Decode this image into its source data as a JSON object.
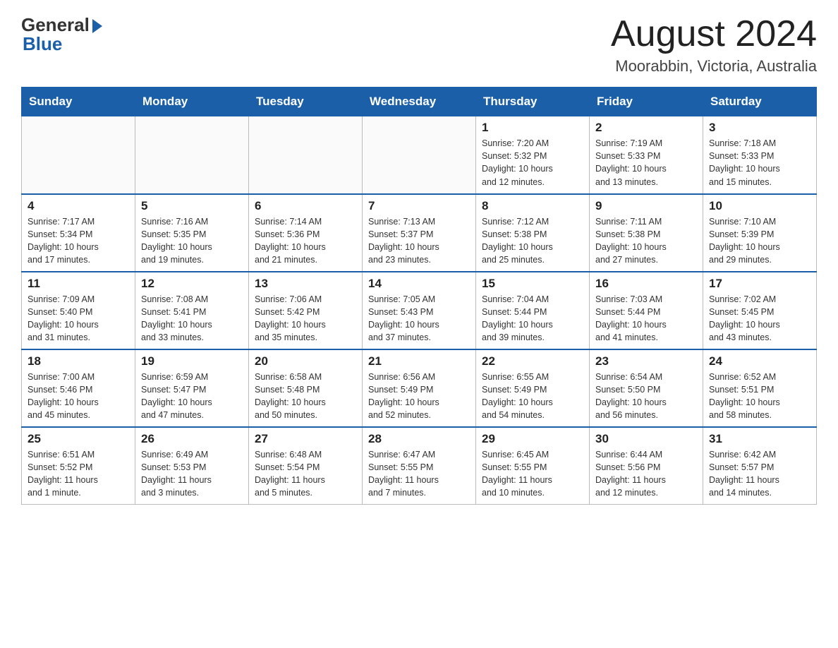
{
  "logo": {
    "general": "General",
    "blue": "Blue"
  },
  "title": "August 2024",
  "location": "Moorabbin, Victoria, Australia",
  "days_of_week": [
    "Sunday",
    "Monday",
    "Tuesday",
    "Wednesday",
    "Thursday",
    "Friday",
    "Saturday"
  ],
  "weeks": [
    [
      {
        "day": "",
        "info": ""
      },
      {
        "day": "",
        "info": ""
      },
      {
        "day": "",
        "info": ""
      },
      {
        "day": "",
        "info": ""
      },
      {
        "day": "1",
        "info": "Sunrise: 7:20 AM\nSunset: 5:32 PM\nDaylight: 10 hours\nand 12 minutes."
      },
      {
        "day": "2",
        "info": "Sunrise: 7:19 AM\nSunset: 5:33 PM\nDaylight: 10 hours\nand 13 minutes."
      },
      {
        "day": "3",
        "info": "Sunrise: 7:18 AM\nSunset: 5:33 PM\nDaylight: 10 hours\nand 15 minutes."
      }
    ],
    [
      {
        "day": "4",
        "info": "Sunrise: 7:17 AM\nSunset: 5:34 PM\nDaylight: 10 hours\nand 17 minutes."
      },
      {
        "day": "5",
        "info": "Sunrise: 7:16 AM\nSunset: 5:35 PM\nDaylight: 10 hours\nand 19 minutes."
      },
      {
        "day": "6",
        "info": "Sunrise: 7:14 AM\nSunset: 5:36 PM\nDaylight: 10 hours\nand 21 minutes."
      },
      {
        "day": "7",
        "info": "Sunrise: 7:13 AM\nSunset: 5:37 PM\nDaylight: 10 hours\nand 23 minutes."
      },
      {
        "day": "8",
        "info": "Sunrise: 7:12 AM\nSunset: 5:38 PM\nDaylight: 10 hours\nand 25 minutes."
      },
      {
        "day": "9",
        "info": "Sunrise: 7:11 AM\nSunset: 5:38 PM\nDaylight: 10 hours\nand 27 minutes."
      },
      {
        "day": "10",
        "info": "Sunrise: 7:10 AM\nSunset: 5:39 PM\nDaylight: 10 hours\nand 29 minutes."
      }
    ],
    [
      {
        "day": "11",
        "info": "Sunrise: 7:09 AM\nSunset: 5:40 PM\nDaylight: 10 hours\nand 31 minutes."
      },
      {
        "day": "12",
        "info": "Sunrise: 7:08 AM\nSunset: 5:41 PM\nDaylight: 10 hours\nand 33 minutes."
      },
      {
        "day": "13",
        "info": "Sunrise: 7:06 AM\nSunset: 5:42 PM\nDaylight: 10 hours\nand 35 minutes."
      },
      {
        "day": "14",
        "info": "Sunrise: 7:05 AM\nSunset: 5:43 PM\nDaylight: 10 hours\nand 37 minutes."
      },
      {
        "day": "15",
        "info": "Sunrise: 7:04 AM\nSunset: 5:44 PM\nDaylight: 10 hours\nand 39 minutes."
      },
      {
        "day": "16",
        "info": "Sunrise: 7:03 AM\nSunset: 5:44 PM\nDaylight: 10 hours\nand 41 minutes."
      },
      {
        "day": "17",
        "info": "Sunrise: 7:02 AM\nSunset: 5:45 PM\nDaylight: 10 hours\nand 43 minutes."
      }
    ],
    [
      {
        "day": "18",
        "info": "Sunrise: 7:00 AM\nSunset: 5:46 PM\nDaylight: 10 hours\nand 45 minutes."
      },
      {
        "day": "19",
        "info": "Sunrise: 6:59 AM\nSunset: 5:47 PM\nDaylight: 10 hours\nand 47 minutes."
      },
      {
        "day": "20",
        "info": "Sunrise: 6:58 AM\nSunset: 5:48 PM\nDaylight: 10 hours\nand 50 minutes."
      },
      {
        "day": "21",
        "info": "Sunrise: 6:56 AM\nSunset: 5:49 PM\nDaylight: 10 hours\nand 52 minutes."
      },
      {
        "day": "22",
        "info": "Sunrise: 6:55 AM\nSunset: 5:49 PM\nDaylight: 10 hours\nand 54 minutes."
      },
      {
        "day": "23",
        "info": "Sunrise: 6:54 AM\nSunset: 5:50 PM\nDaylight: 10 hours\nand 56 minutes."
      },
      {
        "day": "24",
        "info": "Sunrise: 6:52 AM\nSunset: 5:51 PM\nDaylight: 10 hours\nand 58 minutes."
      }
    ],
    [
      {
        "day": "25",
        "info": "Sunrise: 6:51 AM\nSunset: 5:52 PM\nDaylight: 11 hours\nand 1 minute."
      },
      {
        "day": "26",
        "info": "Sunrise: 6:49 AM\nSunset: 5:53 PM\nDaylight: 11 hours\nand 3 minutes."
      },
      {
        "day": "27",
        "info": "Sunrise: 6:48 AM\nSunset: 5:54 PM\nDaylight: 11 hours\nand 5 minutes."
      },
      {
        "day": "28",
        "info": "Sunrise: 6:47 AM\nSunset: 5:55 PM\nDaylight: 11 hours\nand 7 minutes."
      },
      {
        "day": "29",
        "info": "Sunrise: 6:45 AM\nSunset: 5:55 PM\nDaylight: 11 hours\nand 10 minutes."
      },
      {
        "day": "30",
        "info": "Sunrise: 6:44 AM\nSunset: 5:56 PM\nDaylight: 11 hours\nand 12 minutes."
      },
      {
        "day": "31",
        "info": "Sunrise: 6:42 AM\nSunset: 5:57 PM\nDaylight: 11 hours\nand 14 minutes."
      }
    ]
  ]
}
